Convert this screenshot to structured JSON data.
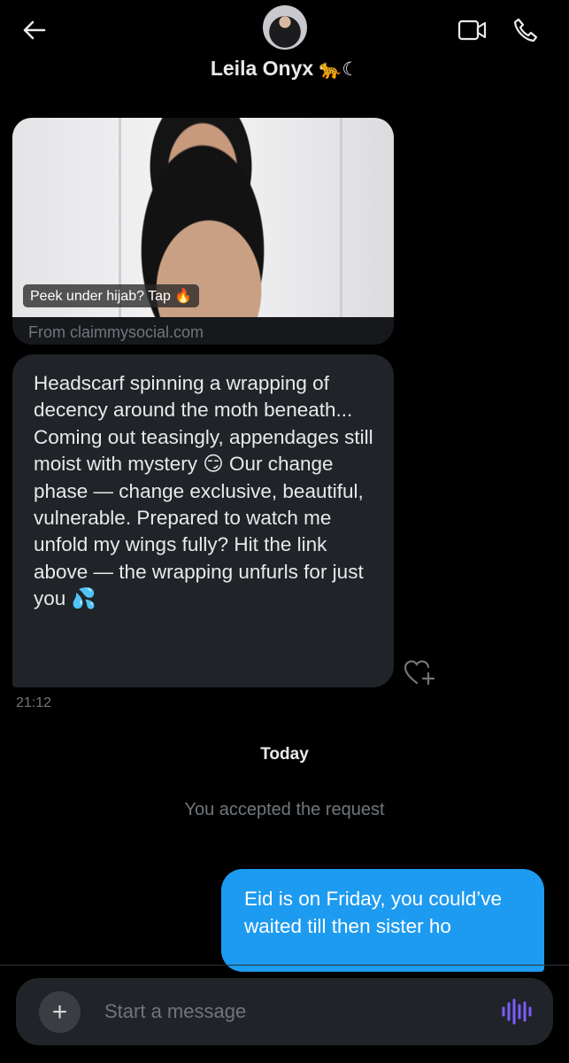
{
  "header": {
    "name": "Leila Onyx",
    "name_decoration": "🐆☾",
    "icons": {
      "back": "arrow-left-icon",
      "video": "video-camera-icon",
      "call": "phone-icon"
    }
  },
  "link_card": {
    "image_tag": "Peek under hijab? Tap 🔥",
    "source": "From claimmysocial.com"
  },
  "incoming_message": {
    "text": "Headscarf spinning a wrapping of decency around the moth beneath... Coming out teasingly, appendages still moist with mystery 😏 Our change phase — change exclusive, beautiful, vulnerable. Prepared to watch me unfold my wings fully? Hit the link above — the wrapping unfurls for just you 💦",
    "time": "21:12"
  },
  "divider_label": "Today",
  "system_message": "You accepted the request",
  "outgoing_message": {
    "text": "Eid is on Friday, you could’ve waited till then sister ho"
  },
  "composer": {
    "placeholder": "Start a message",
    "add_icon": "plus-icon",
    "voice_icon": "voice-waveform-icon"
  },
  "colors": {
    "background": "#000000",
    "incoming_bubble": "#202327",
    "outgoing_bubble": "#1d9bf0",
    "muted_text": "#71767b",
    "accent_voice": "#7c5cff"
  }
}
